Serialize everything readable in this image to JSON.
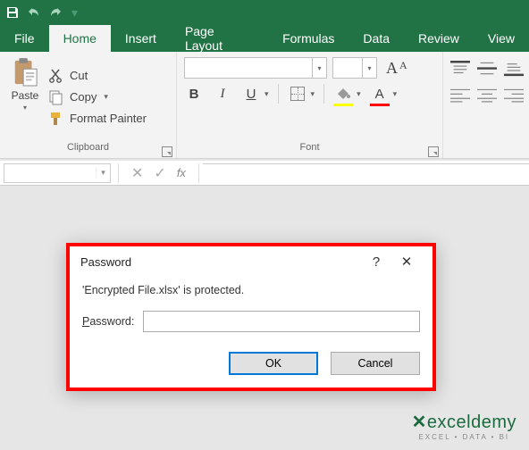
{
  "qat": {
    "customize_caret": "▾"
  },
  "tabs": [
    "File",
    "Home",
    "Insert",
    "Page Layout",
    "Formulas",
    "Data",
    "Review",
    "View"
  ],
  "active_tab": 1,
  "clipboard": {
    "paste": "Paste",
    "cut": "Cut",
    "copy": "Copy",
    "format_painter": "Format Painter",
    "group_label": "Clipboard"
  },
  "font": {
    "group_label": "Font",
    "name_value": "",
    "size_value": "",
    "bold_glyph": "B",
    "italic_glyph": "I",
    "underline_glyph": "U",
    "font_color_glyph": "A",
    "font_color_bar": "#ff0000",
    "fill_color_bar": "#ffff00",
    "grow_glyph": "A",
    "shrink_glyph": "A"
  },
  "formula_bar": {
    "namebox_value": "",
    "cancel_glyph": "✕",
    "enter_glyph": "✓",
    "fx_label": "fx",
    "formula_value": ""
  },
  "dialog": {
    "title": "Password",
    "help_glyph": "?",
    "close_glyph": "✕",
    "message": "'Encrypted File.xlsx' is protected.",
    "label_accel": "P",
    "label_rest": "assword:",
    "input_value": "",
    "ok": "OK",
    "cancel": "Cancel"
  },
  "watermark": {
    "brand": "exceldemy",
    "tagline": "EXCEL • DATA • BI"
  }
}
